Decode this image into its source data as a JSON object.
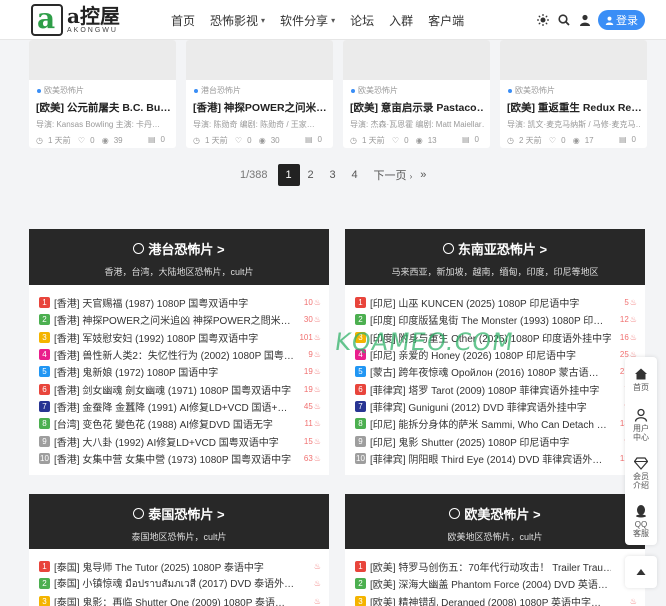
{
  "header": {
    "logo_text": "a控屋",
    "logo_sub": "AKONGWU",
    "logo_letter": "a",
    "nav": [
      {
        "label": "首页",
        "dropdown": false
      },
      {
        "label": "恐怖影视",
        "dropdown": true
      },
      {
        "label": "软件分享",
        "dropdown": true
      },
      {
        "label": "论坛",
        "dropdown": false
      },
      {
        "label": "入群",
        "dropdown": false
      },
      {
        "label": "客户端",
        "dropdown": false
      }
    ],
    "login_label": "登录",
    "icons": [
      "theme-toggle-icon",
      "search-icon",
      "bell-icon",
      "user-icon"
    ]
  },
  "cards": [
    {
      "category": "欧美恐怖片",
      "title": "[欧美] 公元前屠夫 B.C. Bu…",
      "meta": "导演: Kansas Bowling 主演: 卡丹…",
      "time": "1 天前",
      "likes": "0",
      "views": "39",
      "comments": "0"
    },
    {
      "category": "港台恐怖片",
      "title": "[香港] 神探POWER之问米…",
      "meta": "导演: 陈勋奇 编剧: 陈勋奇 / 王家…",
      "time": "1 天前",
      "likes": "0",
      "views": "30",
      "comments": "0"
    },
    {
      "category": "欧美恐怖片",
      "title": "[欧美] 意亩启示录 Pastaco…",
      "meta": "导演: 杰森·瓦恩霍 编剧: Matt Maiellar…",
      "time": "1 天前",
      "likes": "0",
      "views": "13",
      "comments": "0"
    },
    {
      "category": "欧美恐怖片",
      "title": "[欧美] 重返重生 Redux Re…",
      "meta": "导演: 凯文·麦克马纳斯 / 马修·麦克马…",
      "time": "2 天前",
      "likes": "0",
      "views": "17",
      "comments": "0"
    }
  ],
  "pagination": {
    "info": "1/388",
    "pages": [
      "1",
      "2",
      "3",
      "4"
    ],
    "current": "1",
    "next": "下一页",
    "last": "»"
  },
  "boxes": [
    {
      "title": "港台恐怖片 >",
      "subtitle": "香港，台湾，大陆地区恐怖片，cult片",
      "items": [
        {
          "n": "1",
          "text": "[香港] 天官赐福 (1987) 1080P 国粤双语中字",
          "count": "10"
        },
        {
          "n": "2",
          "text": "[香港] 神探POWER之问米追凶 神探POWER之問米…",
          "count": "30"
        },
        {
          "n": "3",
          "text": "[香港] 军妓慰安妇 (1992) 1080P 国粤双语中字",
          "count": "101"
        },
        {
          "n": "4",
          "text": "[香港] 兽性新人类2：失忆性行为 (2002) 1080P 国粤…",
          "count": "9"
        },
        {
          "n": "5",
          "text": "[香港] 鬼新娘 (1972) 1080P 国语中字",
          "count": "19"
        },
        {
          "n": "6",
          "text": "[香港] 剑女幽魂 劍女幽魂 (1971) 1080P 国粤双语中字",
          "count": "19"
        },
        {
          "n": "7",
          "text": "[香港] 金蚕降 金蠶降 (1991) AI修复LD+VCD 国语+…",
          "count": "45"
        },
        {
          "n": "8",
          "text": "[台湾] 变色花 變色花 (1988) AI修复DVD 国语无字",
          "count": "11"
        },
        {
          "n": "9",
          "text": "[香港] 大八卦 (1992) AI修复LD+VCD 国粤双语中字",
          "count": "15"
        },
        {
          "n": "10",
          "text": "[香港] 女集中营 女集中營 (1973) 1080P 国粤双语中字",
          "count": "63"
        }
      ]
    },
    {
      "title": "东南亚恐怖片 >",
      "subtitle": "马来西亚，新加坡，越南，缅甸，印度，印尼等地区",
      "items": [
        {
          "n": "1",
          "text": "[印尼] 山巫 KUNCEN (2025) 1080P 印尼语中字",
          "count": "5"
        },
        {
          "n": "2",
          "text": "[印度] 印度版猛鬼街 The Monster (1993) 1080P 印…",
          "count": "12"
        },
        {
          "n": "3",
          "text": "[印度] 附身与重生 Other (2025) 1080P 印度语外挂中字",
          "count": "16"
        },
        {
          "n": "4",
          "text": "[印尼] 亲爱的 Honey (2026) 1080P 印尼语中字",
          "count": "25"
        },
        {
          "n": "5",
          "text": "[蒙古] 跨年夜惊魂 Оройлон (2016) 1080P 蒙古语…",
          "count": "21"
        },
        {
          "n": "6",
          "text": "[菲律宾] 塔罗 Tarot (2009) 1080P 菲律宾语外挂中字",
          "count": "7"
        },
        {
          "n": "7",
          "text": "[菲律宾] Guniguni (2012) DVD 菲律宾语外挂中字",
          "count": "9"
        },
        {
          "n": "8",
          "text": "[印尼] 能拆分身体的萨米 Sammi, Who Can Detach …",
          "count": "13"
        },
        {
          "n": "9",
          "text": "[印尼] 鬼影 Shutter (2025) 1080P 印尼语中字",
          "count": "9"
        },
        {
          "n": "10",
          "text": "[菲律宾] 阴阳眼 Third Eye (2014) DVD 菲律宾语外…",
          "count": "12"
        }
      ]
    },
    {
      "title": "泰国恐怖片 >",
      "subtitle": "泰国地区恐怖片，cult片",
      "items": [
        {
          "n": "1",
          "text": "[泰国] 鬼导师 The Tutor (2025) 1080P 泰语中字",
          "count": ""
        },
        {
          "n": "2",
          "text": "[泰国] 小镇惊魂 มือปราบสัมภเวสี (2017) DVD 泰语外…",
          "count": ""
        },
        {
          "n": "3",
          "text": "[泰国] 鬼影：再临 Shutter One (2009) 1080P 泰语…",
          "count": ""
        }
      ]
    },
    {
      "title": "欧美恐怖片 >",
      "subtitle": "欧美地区恐怖片，cult片",
      "items": [
        {
          "n": "1",
          "text": "[欧美] 特罗马创伤五：70年代行动攻击！ Trailer Trau…",
          "count": ""
        },
        {
          "n": "2",
          "text": "[欧美] 深海大幽盖 Phantom Force (2004) DVD 英语…",
          "count": ""
        },
        {
          "n": "3",
          "text": "[欧美] 精神错乱 Deranged (2008) 1080P 英语中字…",
          "count": ""
        }
      ]
    }
  ],
  "watermark": "KQAMEO.COM",
  "side_toolbar": [
    {
      "label": "首页",
      "icon": "home-icon"
    },
    {
      "label": "用户中心",
      "icon": "user-center-icon"
    },
    {
      "label": "会员介绍",
      "icon": "diamond-icon"
    },
    {
      "label": "QQ客服",
      "icon": "qq-icon"
    }
  ],
  "colors": {
    "accent": "#3a8ef6",
    "box_head": "#282828",
    "count": "#f07070"
  }
}
